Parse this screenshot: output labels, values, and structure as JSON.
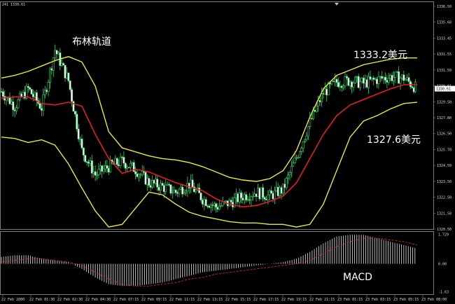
{
  "chart_data": [
    {
      "type": "candlestick",
      "header": "241 1330.61",
      "annotations": {
        "band_label": "布林轨道",
        "upper_level": "1333.2美元",
        "lower_level": "1327.6美元"
      },
      "yticks": [
        "1336.50",
        "1335.60",
        "1333.45",
        "1331.55",
        "1331.50",
        "1330.61",
        "1329.50",
        "1327.80",
        "1326.50",
        "1325.70",
        "1324.50",
        "1323.50",
        "1322.50",
        "1321.50",
        "1320.50"
      ],
      "current_price_label": "1330.61",
      "xticks": [
        "22 Feb 2000",
        "22 Feb 01:30",
        "22 Feb 02:30",
        "22 Feb 04:30",
        "22 Feb 07:15",
        "22 Feb 09:15",
        "22 Feb 11:15",
        "22 Feb 13:15",
        "22 Feb 15:15",
        "22 Feb 17:15",
        "22 Feb 19:15",
        "22 Feb 21:15",
        "23 Feb 01:15",
        "23 Feb 03:15",
        "23 Feb 05:15",
        "23 Feb 08:00"
      ],
      "ylim": [
        1320.2,
        1336.8
      ],
      "series": [
        {
          "name": "",
          "role": "bb-upper",
          "color": "#e8e840",
          "values": [
            1331.4,
            1331.6,
            1331.9,
            1332.3,
            1332.7,
            1333.0,
            1332.6,
            1330.8,
            1327.4,
            1326.2,
            1325.9,
            1325.6,
            1325.4,
            1325.3,
            1325.1,
            1324.8,
            1324.4,
            1324.0,
            1323.8,
            1323.7,
            1323.9,
            1324.5,
            1326.0,
            1328.5,
            1330.6,
            1331.6,
            1332.0,
            1332.4,
            1332.6,
            1332.8,
            1332.9,
            1332.9
          ]
        },
        {
          "name": "",
          "role": "bb-middle",
          "color": "#e02020",
          "values": [
            1329.9,
            1330.0,
            1330.0,
            1329.5,
            1329.4,
            1329.6,
            1329.3,
            1327.2,
            1325.4,
            1324.3,
            1324.6,
            1324.4,
            1324.0,
            1323.6,
            1323.3,
            1323.0,
            1322.4,
            1322.0,
            1321.8,
            1321.9,
            1322.2,
            1322.6,
            1323.6,
            1325.4,
            1327.2,
            1328.6,
            1329.4,
            1329.8,
            1330.2,
            1330.6,
            1330.9,
            1330.9
          ]
        },
        {
          "name": "",
          "role": "bb-lower",
          "color": "#e8e840",
          "values": [
            1327.0,
            1326.9,
            1326.6,
            1326.8,
            1326.4,
            1325.0,
            1323.2,
            1321.5,
            1320.3,
            1320.5,
            1321.7,
            1322.9,
            1322.7,
            1322.0,
            1321.4,
            1321.1,
            1320.9,
            1320.7,
            1320.6,
            1320.6,
            1320.5,
            1320.5,
            1320.3,
            1320.5,
            1322.0,
            1324.5,
            1327.0,
            1328.2,
            1328.6,
            1329.1,
            1329.5,
            1329.6
          ]
        }
      ],
      "price": {
        "values": [
          1330.4,
          1329.3,
          1330.6,
          1329.2,
          1333.5,
          1331.2,
          1326.0,
          1324.2,
          1324.8,
          1325.2,
          1324.6,
          1323.6,
          1323.3,
          1322.9,
          1323.5,
          1322.4,
          1321.8,
          1322.1,
          1322.6,
          1322.9,
          1322.6,
          1323.1,
          1325.5,
          1328.1,
          1330.3,
          1331.1,
          1331.2,
          1331.0,
          1331.3,
          1331.5,
          1331.4,
          1330.6
        ]
      },
      "macd": {
        "label": "MACD",
        "yticks": [
          "1.729",
          "0.00",
          "-1.63"
        ],
        "ylim": [
          -1.7,
          1.75
        ],
        "histogram": [
          0.4,
          0.5,
          0.5,
          0.3,
          0.2,
          0.1,
          -0.3,
          -0.8,
          -1.2,
          -1.3,
          -1.3,
          -1.2,
          -1.1,
          -0.9,
          -0.7,
          -0.5,
          -0.4,
          -0.3,
          -0.2,
          -0.1,
          0.0,
          0.1,
          0.3,
          0.7,
          1.2,
          1.6,
          1.7,
          1.7,
          1.5,
          1.3,
          1.1,
          0.9
        ],
        "signal": [
          0.1,
          0.2,
          0.3,
          0.3,
          0.2,
          0.1,
          -0.1,
          -0.5,
          -0.9,
          -1.2,
          -1.3,
          -1.3,
          -1.2,
          -1.1,
          -0.9,
          -0.8,
          -0.6,
          -0.5,
          -0.4,
          -0.3,
          -0.2,
          -0.1,
          0.0,
          0.2,
          0.6,
          1.0,
          1.3,
          1.5,
          1.5,
          1.4,
          1.3,
          1.1
        ]
      }
    }
  ]
}
